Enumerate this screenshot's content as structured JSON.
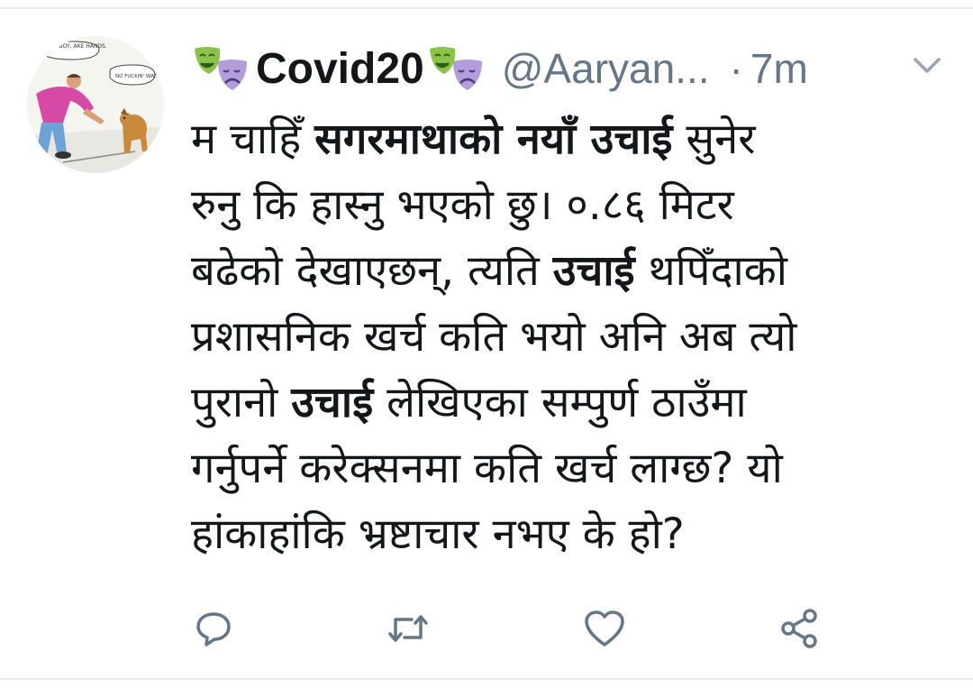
{
  "tweet": {
    "display_name": "Covid20",
    "handle": "@Aaryan...",
    "separator": "·",
    "timestamp": "7m",
    "name_emoji": "theater-masks-icon",
    "text_lines": [
      [
        {
          "t": "म चाहिँ ",
          "b": false
        },
        {
          "t": "सगरमाथाको नयाँ उचाई",
          "b": true
        },
        {
          "t": " सुनेर",
          "b": false
        }
      ],
      [
        {
          "t": "रुनु कि हास्नु भएको छु। ०.८६ मिटर",
          "b": false
        }
      ],
      [
        {
          "t": "बढेको देखाएछन्, त्यति ",
          "b": false
        },
        {
          "t": "उचाई",
          "b": true
        },
        {
          "t": " थपिँदाको",
          "b": false
        }
      ],
      [
        {
          "t": "प्रशासनिक खर्च कति भयो अनि अब त्यो",
          "b": false
        }
      ],
      [
        {
          "t": "पुरानो ",
          "b": false
        },
        {
          "t": "उचाई",
          "b": true
        },
        {
          "t": " लेखिएका सम्पुर्ण ठाउँमा",
          "b": false
        }
      ],
      [
        {
          "t": "गर्नुपर्ने करेक्सनमा कति खर्च लाग्छ? यो",
          "b": false
        }
      ],
      [
        {
          "t": "हांकाहांकि भ्रष्टाचार नभए के हो?",
          "b": false
        }
      ]
    ]
  },
  "avatar": {
    "speech_left": "... BOY, AKE HANDS.",
    "speech_right": "NO FUCKIN' WAY."
  },
  "actions": [
    {
      "name": "reply-button",
      "icon": "reply-icon"
    },
    {
      "name": "retweet-button",
      "icon": "retweet-icon"
    },
    {
      "name": "like-button",
      "icon": "heart-icon"
    },
    {
      "name": "share-button",
      "icon": "share-icon"
    }
  ],
  "colors": {
    "text": "#14171a",
    "secondary": "#657786",
    "divider": "#e6ecf0",
    "mask_happy": "#8bc34a",
    "mask_sad": "#b39ddb"
  }
}
